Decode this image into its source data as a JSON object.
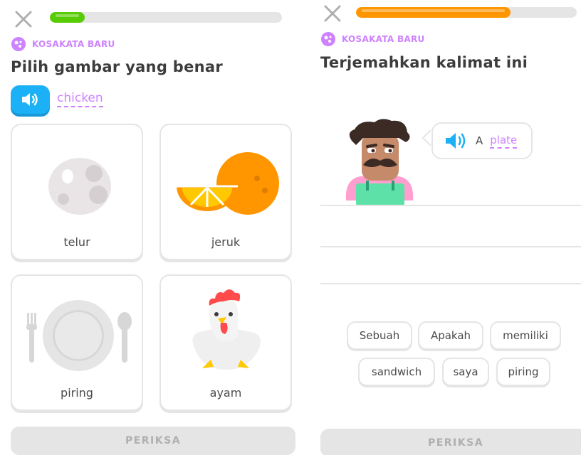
{
  "colors": {
    "accent_purple": "#ce82ff",
    "speaker_blue": "#1cb0f6",
    "progress_green": "#58cc02",
    "progress_orange": "#ff9600",
    "disabled_gray": "#e5e5e5"
  },
  "left": {
    "progress": 0.15,
    "badge_icon": "sparkle-icon",
    "badge": "KOSAKATA BARU",
    "title": "Pilih gambar yang benar",
    "audio_word": "chicken",
    "choices": [
      {
        "label": "telur",
        "icon": "egg-icon"
      },
      {
        "label": "jeruk",
        "icon": "orange-icon"
      },
      {
        "label": "piring",
        "icon": "plate-icon"
      },
      {
        "label": "ayam",
        "icon": "chicken-icon"
      }
    ],
    "check": "PERIKSA"
  },
  "right": {
    "progress": 0.7,
    "badge_icon": "sparkle-icon",
    "badge": "KOSAKATA BARU",
    "title": "Terjemahkan kalimat ini",
    "sentence_article": "A",
    "sentence_word": "plate",
    "word_bank": [
      "Sebuah",
      "Apakah",
      "memiliki",
      "sandwich",
      "saya",
      "piring"
    ],
    "check": "PERIKSA"
  }
}
